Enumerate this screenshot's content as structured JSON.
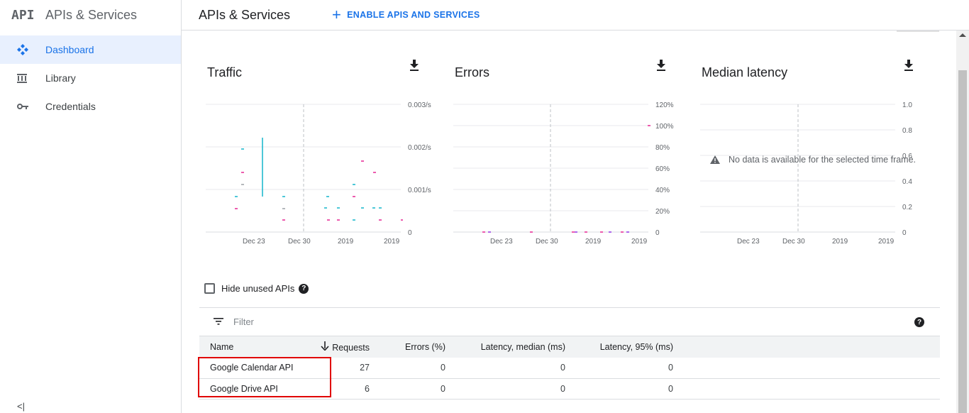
{
  "sidebar": {
    "logo": "API",
    "title": "APIs & Services",
    "items": [
      {
        "label": "Dashboard",
        "icon": "dashboard-icon",
        "active": true
      },
      {
        "label": "Library",
        "icon": "library-icon",
        "active": false
      },
      {
        "label": "Credentials",
        "icon": "key-icon",
        "active": false
      }
    ],
    "collapse_label": "<|"
  },
  "header": {
    "title": "APIs & Services",
    "enable_button": "ENABLE APIS AND SERVICES"
  },
  "charts": {
    "traffic": {
      "title": "Traffic",
      "x_ticks": [
        "Dec 23",
        "Dec 30",
        "2019",
        "2019"
      ],
      "y_ticks": [
        "0.003/s",
        "0.002/s",
        "0.001/s",
        "0"
      ]
    },
    "errors": {
      "title": "Errors",
      "x_ticks": [
        "Dec 23",
        "Dec 30",
        "2019",
        "2019"
      ],
      "y_ticks": [
        "120%",
        "100%",
        "80%",
        "60%",
        "40%",
        "20%",
        "0"
      ]
    },
    "latency": {
      "title": "Median latency",
      "x_ticks": [
        "Dec 23",
        "Dec 30",
        "2019",
        "2019"
      ],
      "y_ticks": [
        "1.0",
        "0.8",
        "0.6",
        "0.4",
        "0.2",
        "0"
      ],
      "no_data": "No data is available for the selected time frame."
    }
  },
  "chart_data": [
    {
      "type": "scatter",
      "title": "Traffic",
      "ylim": [
        0,
        0.003
      ],
      "colors": [
        "#12b5cb",
        "#e52592"
      ]
    },
    {
      "type": "scatter",
      "title": "Errors",
      "ylim": [
        0,
        1.2
      ],
      "colors": [
        "#e52592",
        "#9334e6"
      ]
    },
    {
      "type": "line",
      "title": "Median latency",
      "ylim": [
        0,
        1.0
      ]
    }
  ],
  "hide_unused": {
    "label": "Hide unused APIs",
    "checked": false
  },
  "filter": {
    "placeholder": "Filter"
  },
  "table": {
    "columns": [
      "Name",
      "Requests",
      "Errors (%)",
      "Latency, median (ms)",
      "Latency, 95% (ms)"
    ],
    "rows": [
      {
        "name": "Google Calendar API",
        "requests": "27",
        "errors": "0",
        "latency_median": "0",
        "latency_95": "0"
      },
      {
        "name": "Google Drive API",
        "requests": "6",
        "errors": "0",
        "latency_median": "0",
        "latency_95": "0"
      }
    ]
  },
  "colors": {
    "accent": "#1a73e8",
    "highlight": "#e00000"
  }
}
